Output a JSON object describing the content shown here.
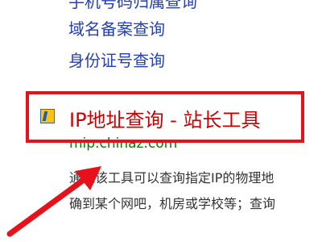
{
  "links": {
    "cut_label": "手机号码归属查询",
    "domain_label": "域名备案查询",
    "id_label": "身份证号查询"
  },
  "result": {
    "title": "IP地址查询 - 站长工具",
    "url": "mip.chinaz.com",
    "snippet_line1": "通过该工具可以查询指定IP的物理地",
    "snippet_line2": "确到某个网吧，机房或学校等；查询"
  },
  "colors": {
    "link": "#2440b3",
    "title": "#c80000",
    "url": "#008000",
    "annotation": "#e6111b"
  },
  "icons": {
    "favicon": "site-favicon-icon",
    "annotation_arrow": "arrow-icon"
  }
}
